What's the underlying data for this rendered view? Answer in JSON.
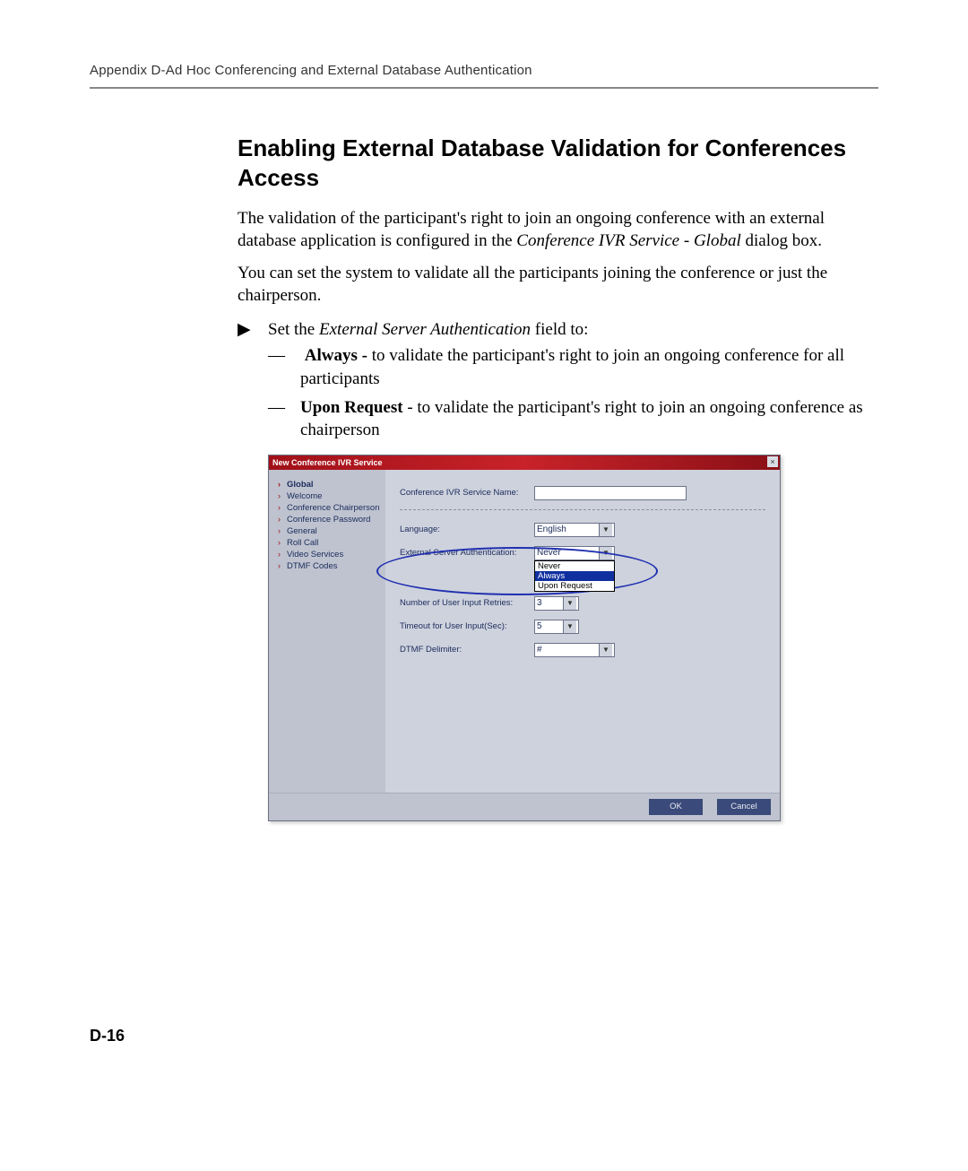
{
  "header": "Appendix D-Ad Hoc Conferencing and External Database Authentication",
  "title": "Enabling External Database Validation for Conferences Access",
  "para1_a": "The validation of the participant's right to join an ongoing conference with an external database application is configured in the ",
  "para1_italic": "Conference IVR Service - Global",
  "para1_b": " dialog box.",
  "para2": "You can set the system to validate all the participants joining the conference or just the chairperson.",
  "bullet_marker": "▶",
  "bullet_a": "Set the ",
  "bullet_italic": "External Server Authentication",
  "bullet_b": " field to:",
  "sub_marker": "—",
  "sub1_bold": "Always - ",
  "sub1_rest": "to validate the participant's right to join an ongoing conference for all participants",
  "sub2_bold": "Upon Request",
  "sub2_rest": " - to validate the participant's right to join an ongoing conference as chairperson",
  "dialog": {
    "title": "New Conference IVR Service",
    "close": "×",
    "side_items": [
      "Global",
      "Welcome",
      "Conference Chairperson",
      "Conference Password",
      "General",
      "Roll Call",
      "Video Services",
      "DTMF Codes"
    ],
    "labels": {
      "service_name": "Conference IVR Service Name:",
      "language": "Language:",
      "ext_auth": "External Server Authentication:",
      "retries": "Number of User Input Retries:",
      "timeout": "Timeout for User Input(Sec):",
      "delimiter": "DTMF Delimiter:"
    },
    "values": {
      "service_name": "",
      "language": "English",
      "ext_auth": "Never",
      "retries": "3",
      "timeout": "5",
      "delimiter": "#"
    },
    "ext_auth_options": [
      "Never",
      "Always",
      "Upon Request"
    ],
    "ext_auth_selected": "Always",
    "ok": "OK",
    "cancel": "Cancel"
  },
  "page_number": "D-16"
}
